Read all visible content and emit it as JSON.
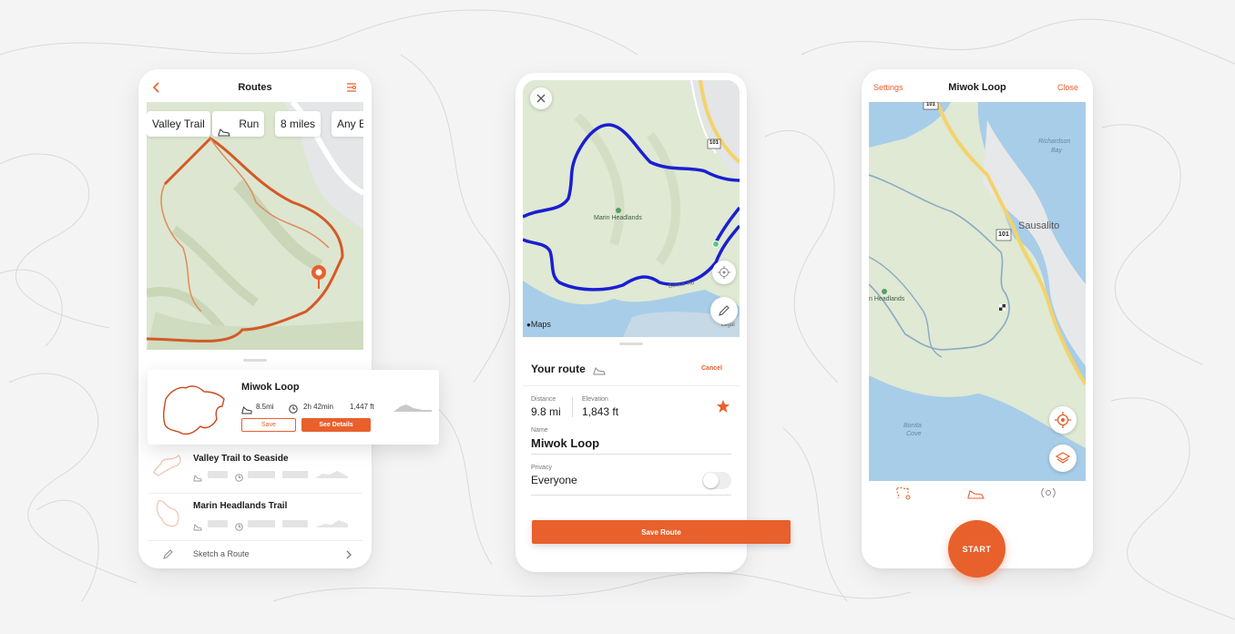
{
  "colors": {
    "accent": "#e8602c",
    "route_blue": "#1a1fd1",
    "map_green": "#dfe9d4",
    "water": "#a8cde8"
  },
  "phone1": {
    "title": "Routes",
    "filters": [
      "Valley Trail",
      "Run",
      "8 miles",
      "Any E"
    ],
    "selected_route": {
      "name": "Miwok Loop",
      "distance": "8.5mi",
      "time": "2h 42min",
      "elevation": "1,447 ft",
      "save_label": "Save",
      "details_label": "See Details"
    },
    "routes": [
      {
        "name": "Valley Trail to Seaside"
      },
      {
        "name": "Marin Headlands Trail"
      }
    ],
    "sketch_label": "Sketch a Route"
  },
  "phone2": {
    "map_label": "Marin Headlands",
    "road_label": "Bunker Rd",
    "highway": "101",
    "legal": "Legal",
    "attribution": "Maps",
    "panel_title": "Your route",
    "cancel_label": "Cancel",
    "distance_label": "Distance",
    "distance_value": "9.8 mi",
    "elevation_label": "Elevation",
    "elevation_value": "1,843 ft",
    "name_label": "Name",
    "name_value": "Miwok Loop",
    "privacy_label": "Privacy",
    "privacy_value": "Everyone",
    "save_button": "Save Route"
  },
  "phone3": {
    "settings_label": "Settings",
    "title": "Miwok Loop",
    "close_label": "Close",
    "place_labels": {
      "richardson": "Richardson",
      "bay": "Bay",
      "sausalito": "Sausalito",
      "headlands": "n Headlands",
      "bonita": "Bonita",
      "cove": "Cove"
    },
    "highway_top": "101",
    "highway_mid": "101",
    "start_label": "START"
  }
}
